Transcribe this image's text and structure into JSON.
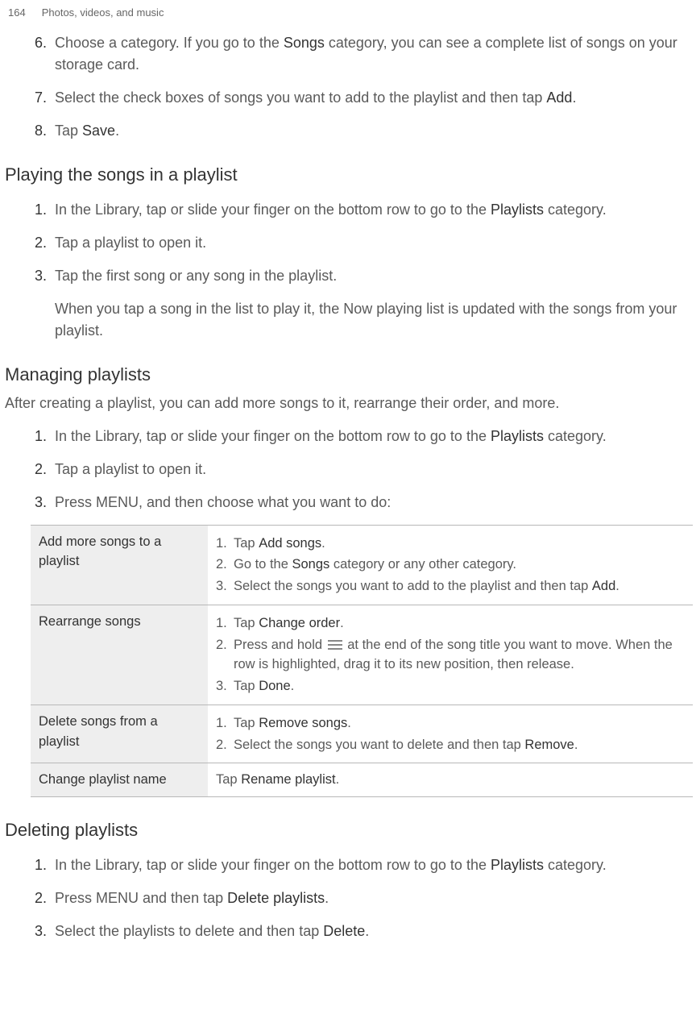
{
  "header": {
    "page_number": "164",
    "chapter": "Photos, videos, and music"
  },
  "steps_top": [
    {
      "n": "6.",
      "pre": "Choose a category. If you go to the ",
      "b1": "Songs",
      "post": " category, you can see a complete list of songs on your storage card."
    },
    {
      "n": "7.",
      "pre": "Select the check boxes of songs you want to add to the playlist and then tap ",
      "b1": "Add",
      "post": "."
    },
    {
      "n": "8.",
      "pre": "Tap ",
      "b1": "Save",
      "post": "."
    }
  ],
  "section_playing": {
    "title": "Playing the songs in a playlist",
    "steps": [
      {
        "n": "1.",
        "pre": "In the Library, tap or slide your finger on the bottom row to go to the ",
        "b1": "Playlists",
        "post": " category."
      },
      {
        "n": "2.",
        "pre": "Tap a playlist to open it.",
        "b1": "",
        "post": ""
      },
      {
        "n": "3.",
        "pre": "Tap the first song or any song in the playlist.",
        "b1": "",
        "post": ""
      }
    ],
    "follow": "When you tap a song in the list to play it, the Now playing list is updated with the songs from your playlist."
  },
  "section_managing": {
    "title": "Managing playlists",
    "intro": "After creating a playlist, you can add more songs to it, rearrange their order, and more.",
    "steps": [
      {
        "n": "1.",
        "pre": "In the Library, tap or slide your finger on the bottom row to go to the ",
        "b1": "Playlists",
        "post": " category."
      },
      {
        "n": "2.",
        "pre": "Tap a playlist to open it.",
        "b1": "",
        "post": ""
      },
      {
        "n": "3.",
        "pre": "Press MENU, and then choose what you want to do:",
        "b1": "",
        "post": ""
      }
    ],
    "table": {
      "row1": {
        "label": "Add more songs to a playlist",
        "i1n": "1.",
        "i1a": "Tap ",
        "i1b": "Add songs",
        "i1c": ".",
        "i2n": "2.",
        "i2a": "Go to the ",
        "i2b": "Songs",
        "i2c": " category or any other category.",
        "i3n": "3.",
        "i3a": "Select the songs you want to add to the playlist and then tap ",
        "i3b": "Add",
        "i3c": "."
      },
      "row2": {
        "label": "Rearrange songs",
        "i1n": "1.",
        "i1a": "Tap ",
        "i1b": "Change order",
        "i1c": ".",
        "i2n": "2.",
        "i2a": "Press and hold ",
        "i2c": " at the end of the song title you want to move. When the row is highlighted, drag it to its new position, then release.",
        "i3n": "3.",
        "i3a": "Tap ",
        "i3b": "Done",
        "i3c": "."
      },
      "row3": {
        "label": "Delete songs from a playlist",
        "i1n": "1.",
        "i1a": "Tap ",
        "i1b": "Remove songs",
        "i1c": ".",
        "i2n": "2.",
        "i2a": "Select the songs you want to delete and then tap ",
        "i2b": "Remove",
        "i2c": "."
      },
      "row4": {
        "label": "Change playlist name",
        "txt_a": "Tap ",
        "txt_b": "Rename playlist",
        "txt_c": "."
      }
    }
  },
  "section_deleting": {
    "title": "Deleting playlists",
    "steps": [
      {
        "n": "1.",
        "pre": "In the Library, tap or slide your finger on the bottom row to go to the ",
        "b1": "Playlists",
        "post": " category."
      },
      {
        "n": "2.",
        "pre": "Press MENU and then tap ",
        "b1": "Delete playlists",
        "post": "."
      },
      {
        "n": "3.",
        "pre": "Select the playlists to delete and then tap ",
        "b1": "Delete",
        "post": "."
      }
    ]
  }
}
